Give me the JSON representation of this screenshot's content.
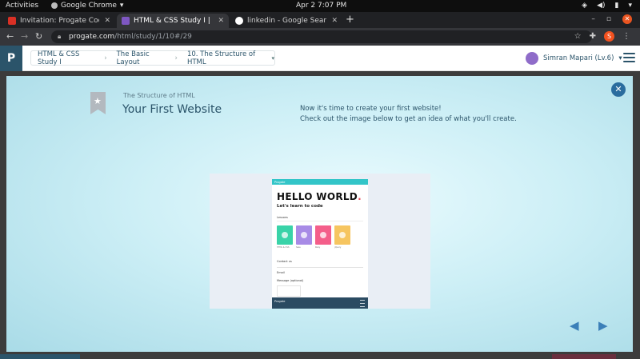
{
  "gnome": {
    "activities": "Activities",
    "app_name": "Google Chrome",
    "app_caret": "▾",
    "clock": "Apr 2   7:07 PM",
    "tray": [
      "wifi-icon",
      "volume-icon",
      "battery-icon",
      "caret-down-icon"
    ]
  },
  "tabs": [
    {
      "title": "Invitation: Progate Code",
      "favicon_color": "#d93025",
      "active": false
    },
    {
      "title": "HTML & CSS Study I | Prog",
      "favicon_color": "#7e57c2",
      "active": true
    },
    {
      "title": "linkedin - Google Search",
      "favicon_color": "#ffffff",
      "active": false
    }
  ],
  "tab_close": "✕",
  "new_tab": "+",
  "window_controls": {
    "minimize": "–",
    "maximize": "▫",
    "close": "✕"
  },
  "address": {
    "host": "progate.com",
    "path": "/html/study/1/10#/29",
    "back": "←",
    "forward": "→",
    "reload": "↻",
    "profile_initial": "S"
  },
  "progate": {
    "logo": "P",
    "breadcrumb": [
      "HTML & CSS Study I",
      "The Basic Layout",
      "10. The Structure of HTML"
    ],
    "crumb_sep": "›",
    "crumb_caret": "▾",
    "user": "Simran Mapari (Lv.6)",
    "user_caret": "▾"
  },
  "modal": {
    "subtitle": "The Structure of HTML",
    "title": "Your First Website",
    "intro_line1": "Now it's time to create your first website!",
    "intro_line2": "Check out the image below to get an idea of what you'll create.",
    "close": "✕",
    "prev": "◀",
    "next": "▶"
  },
  "preview": {
    "brand": "Progate",
    "nav_links": [
      "",
      "",
      ""
    ],
    "hello": "HELLO WORLD",
    "hello_dot": ".",
    "learn": "Let's learn to code",
    "lessons_label": "Lessons",
    "cards": [
      {
        "color": "#39d3a8",
        "label": "HTML & CSS"
      },
      {
        "color": "#a88be6",
        "label": "Sass"
      },
      {
        "color": "#f45e8a",
        "label": "Ruby"
      },
      {
        "color": "#f6c560",
        "label": "jQuery"
      }
    ],
    "contact_label": "Contact us",
    "email_label": "Email",
    "message_label": "Message (optional)",
    "footer_brand": "Progate"
  },
  "colors": {
    "progate_navy": "#2b546a",
    "modal_close": "#2a6c9e",
    "arrow": "#3b7fb8"
  }
}
